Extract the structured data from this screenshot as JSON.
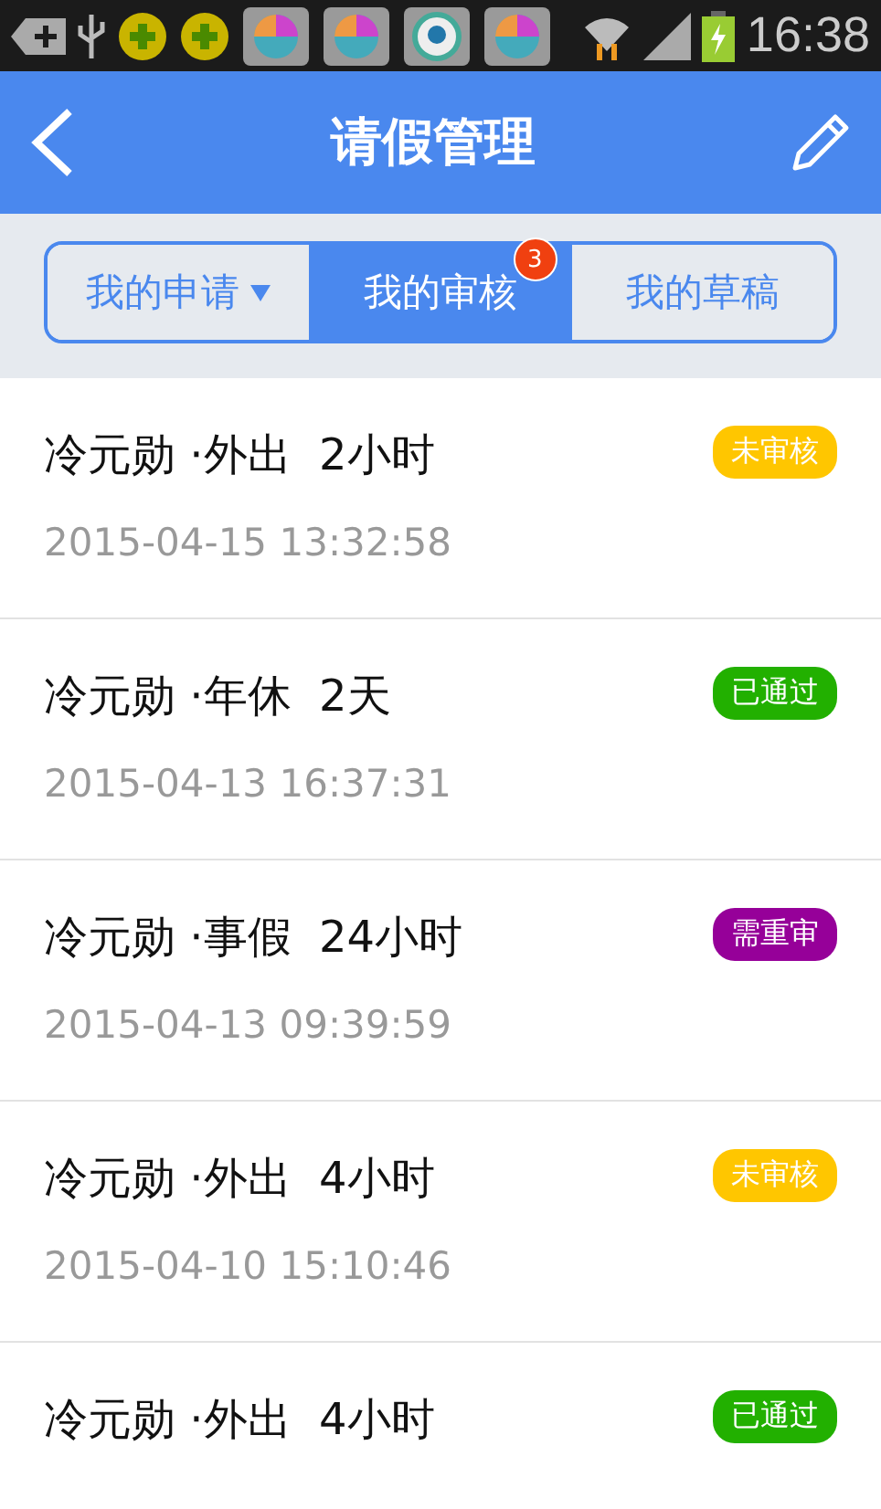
{
  "status_bar": {
    "time": "16:38"
  },
  "header": {
    "title": "请假管理"
  },
  "tabs": [
    {
      "label": "我的申请",
      "selected": false,
      "dropdown": true
    },
    {
      "label": "我的审核",
      "selected": true,
      "badge": "3"
    },
    {
      "label": "我的草稿",
      "selected": false
    }
  ],
  "requests": [
    {
      "title": "冷元勋 ·外出  2小时",
      "time": "2015-04-15 13:32:58",
      "status": "未审核",
      "color": "#ffc600"
    },
    {
      "title": "冷元勋 ·年休  2天",
      "time": "2015-04-13 16:37:31",
      "status": "已通过",
      "color": "#22b000"
    },
    {
      "title": "冷元勋 ·事假  24小时",
      "time": "2015-04-13 09:39:59",
      "status": "需重审",
      "color": "#960099"
    },
    {
      "title": "冷元勋 ·外出  4小时",
      "time": "2015-04-10 15:10:46",
      "status": "未审核",
      "color": "#ffc600"
    },
    {
      "title": "冷元勋 ·外出  4小时",
      "status": "已通过",
      "color": "#22b000"
    }
  ]
}
